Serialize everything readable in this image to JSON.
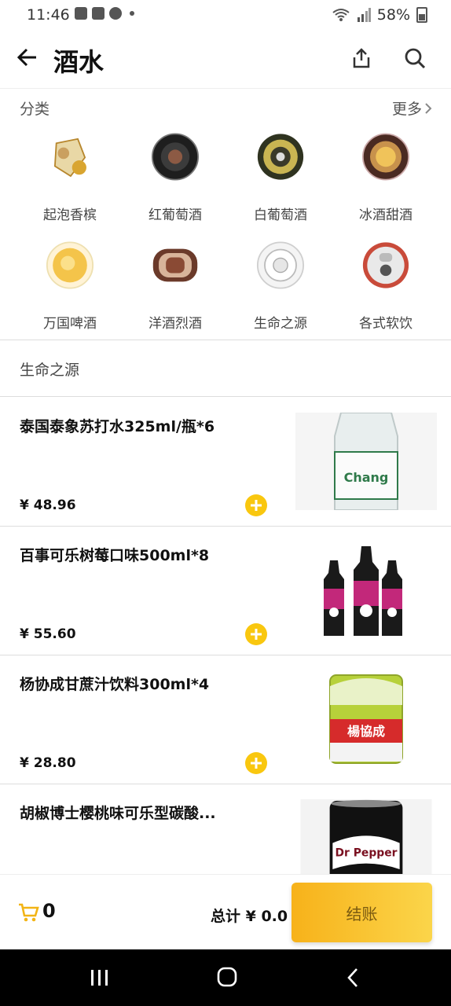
{
  "status_bar": {
    "time": "11:46",
    "battery": "58%"
  },
  "header": {
    "title": "酒水"
  },
  "categories_section": {
    "label": "分类",
    "more": "更多"
  },
  "categories": [
    {
      "label": "起泡香槟"
    },
    {
      "label": "红葡萄酒"
    },
    {
      "label": "白葡萄酒"
    },
    {
      "label": "冰酒甜酒"
    },
    {
      "label": "万国啤酒"
    },
    {
      "label": "洋酒烈酒"
    },
    {
      "label": "生命之源"
    },
    {
      "label": "各式软饮"
    }
  ],
  "section_title": "生命之源",
  "products": [
    {
      "name": "泰国泰象苏打水325ml/瓶*6",
      "price": "¥ 48.96",
      "image_text": "Chang"
    },
    {
      "name": "百事可乐树莓口味500ml*8",
      "price": "¥ 55.60"
    },
    {
      "name": "杨协成甘蔗汁饮料300ml*4",
      "price": "¥ 28.80",
      "image_text": "楊協成"
    },
    {
      "name": "胡椒博士樱桃味可乐型碳酸...",
      "price": "",
      "image_text": "Dr Pepper"
    }
  ],
  "cart": {
    "count": "0",
    "total": "总计 ¥ 0.0",
    "checkout": "结账"
  },
  "colors": {
    "accent": "#f9c70f",
    "checkout_start": "#f7b21a",
    "checkout_end": "#fbd54a"
  }
}
